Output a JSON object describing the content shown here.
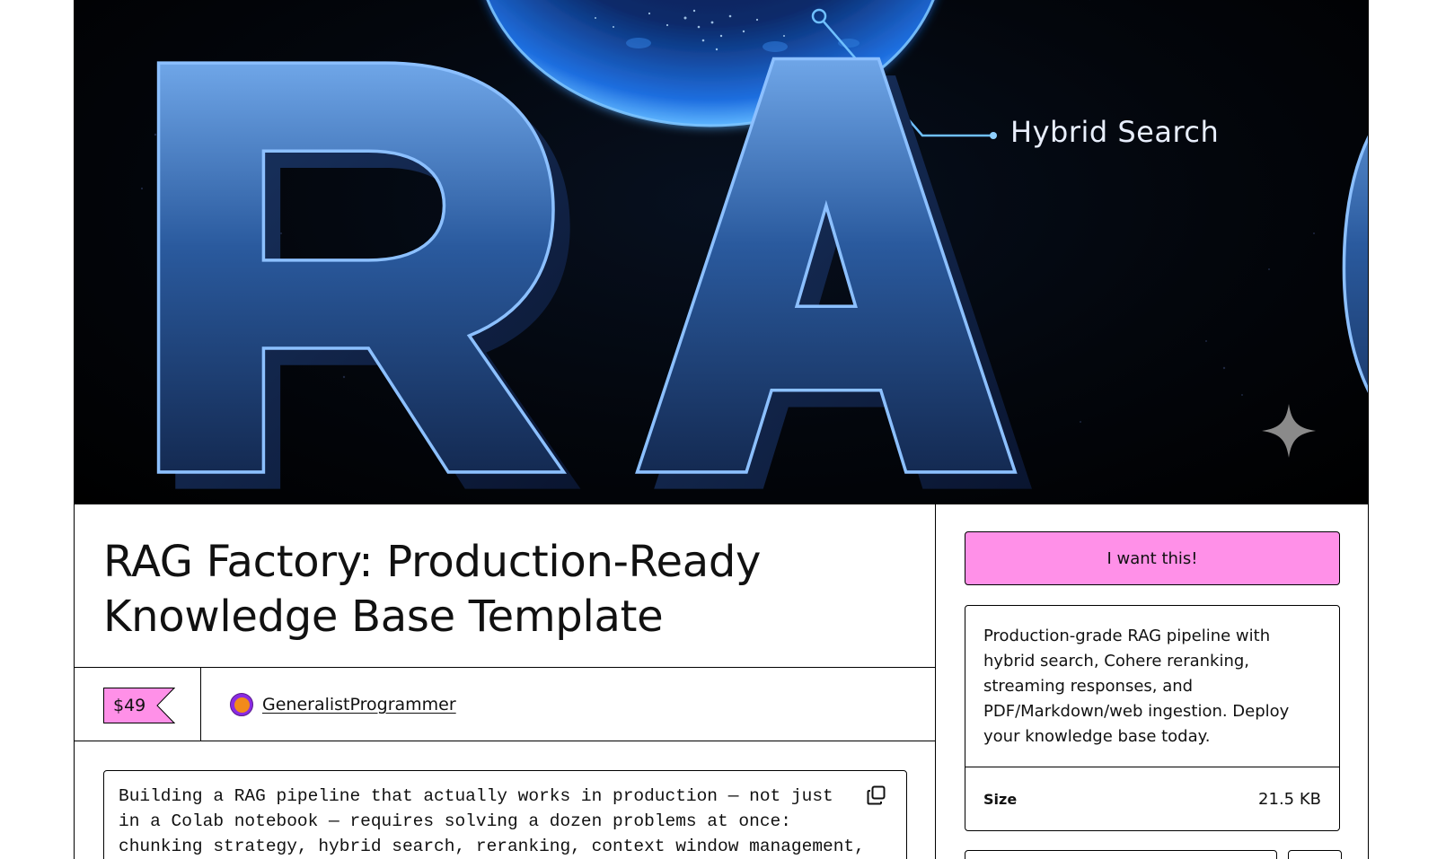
{
  "hero": {
    "label": "Hybrid Search",
    "word": "RAG"
  },
  "product": {
    "title_line1": "RAG Factory: Production-Ready",
    "title_line2": "Knowledge Base Template",
    "price": "$49",
    "author": "GeneralistProgrammer"
  },
  "description": {
    "lines": [
      "Building a RAG pipeline that actually works in production — not just",
      "in a Colab notebook — requires solving a dozen problems at once:",
      "chunking strategy, hybrid search, reranking, context window management,"
    ]
  },
  "sidebar": {
    "buy_label": "I want this!",
    "summary": "Production-grade RAG pipeline with hybrid search, Cohere reranking, streaming responses, and PDF/Markdown/web ingestion. Deploy your knowledge base today.",
    "attributes": [
      {
        "label": "Size",
        "value": "21.5 KB"
      }
    ]
  },
  "colors": {
    "accent_pink": "#ff90e8",
    "hero_bg": "#03060c",
    "glow_blue": "#3fa0ff"
  },
  "icons": {
    "copy": "copy-icon",
    "sparkle": "sparkle-icon"
  }
}
